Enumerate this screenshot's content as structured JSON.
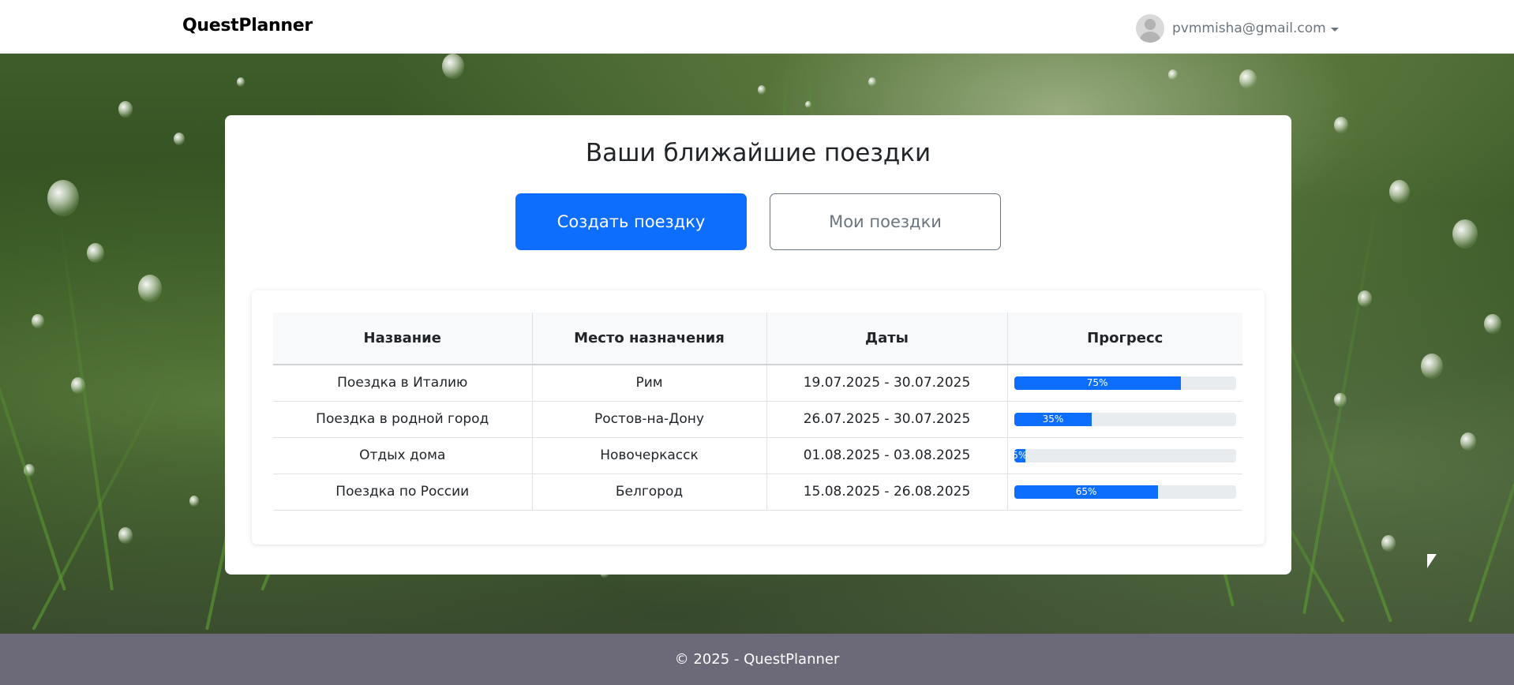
{
  "navbar": {
    "brand": "QuestPlanner",
    "user_email": "pvmmisha@gmail.com",
    "avatar_icon": "user-avatar-icon",
    "caret_icon": "caret-down-icon"
  },
  "main": {
    "title": "Ваши ближайшие поездки",
    "create_button": "Создать поездку",
    "my_trips_button": "Мои поездки"
  },
  "table": {
    "headers": [
      "Название",
      "Место назначения",
      "Даты",
      "Прогресс"
    ],
    "rows": [
      {
        "name": "Поездка в Италию",
        "destination": "Рим",
        "dates": "19.07.2025 - 30.07.2025",
        "progress": 75,
        "progress_label": "75%"
      },
      {
        "name": "Поездка в родной город",
        "destination": "Ростов-на-Дону",
        "dates": "26.07.2025 - 30.07.2025",
        "progress": 35,
        "progress_label": "35%"
      },
      {
        "name": "Отдых дома",
        "destination": "Новочеркасск",
        "dates": "01.08.2025 - 03.08.2025",
        "progress": 5,
        "progress_label": "5%"
      },
      {
        "name": "Поездка по России",
        "destination": "Белгород",
        "dates": "15.08.2025 - 26.08.2025",
        "progress": 65,
        "progress_label": "65%"
      }
    ]
  },
  "footer": {
    "text": "© 2025 - QuestPlanner"
  },
  "colors": {
    "primary": "#0d6efd",
    "footer_bg": "#6c6a78",
    "outline": "#6c757d"
  }
}
